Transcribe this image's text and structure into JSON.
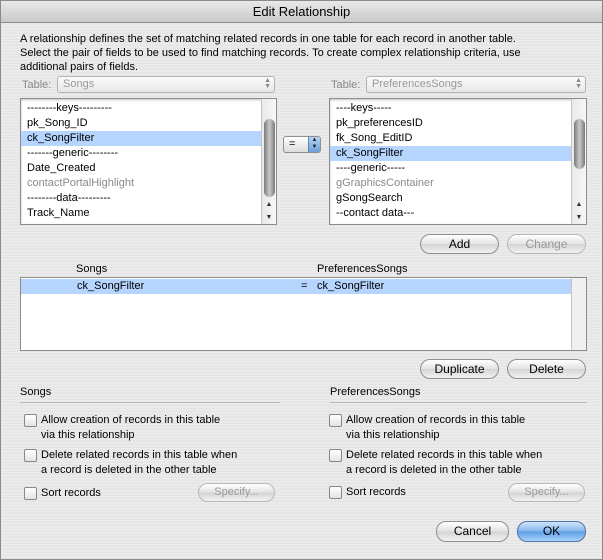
{
  "window": {
    "title": "Edit Relationship"
  },
  "description": [
    "A relationship defines the set of matching related records in one table for each record in another table.",
    "Select the pair of fields to be used to find matching records. To create complex relationship criteria, use",
    "additional pairs of fields."
  ],
  "left_table": {
    "label": "Table:",
    "selected": "Songs",
    "fields": [
      "--------keys---------",
      "pk_Song_ID",
      "ck_SongFilter",
      "-------generic--------",
      "Date_Created",
      "contactPortalHighlight",
      "--------data---------",
      "Track_Name"
    ],
    "selected_index": 2,
    "dim_indices": [
      5
    ]
  },
  "right_table": {
    "label": "Table:",
    "selected": "PreferencesSongs",
    "fields": [
      "----keys-----",
      "pk_preferencesID",
      "fk_Song_EditID",
      "ck_SongFilter",
      "----generic-----",
      "gGraphicsContainer",
      "gSongSearch",
      "--contact data---"
    ],
    "selected_index": 3,
    "dim_indices": [
      5
    ]
  },
  "operator": "=",
  "buttons": {
    "add": "Add",
    "change": "Change",
    "duplicate": "Duplicate",
    "delete": "Delete",
    "specify": "Specify...",
    "cancel": "Cancel",
    "ok": "OK"
  },
  "criteria": {
    "left_header": "Songs",
    "right_header": "PreferencesSongs",
    "rows": [
      {
        "left": "ck_SongFilter",
        "op": "=",
        "right": "ck_SongFilter"
      }
    ]
  },
  "options": {
    "left": {
      "title": "Songs",
      "allow_create": [
        "Allow creation of records in this table",
        "via this relationship"
      ],
      "delete_related": [
        "Delete related records in this table when",
        "a record is deleted in the other table"
      ],
      "sort": "Sort records"
    },
    "right": {
      "title": "PreferencesSongs",
      "allow_create": [
        "Allow creation of records in this table",
        "via this relationship"
      ],
      "delete_related": [
        "Delete related records in this table when",
        "a record is deleted in the other table"
      ],
      "sort": "Sort records"
    }
  },
  "colors": {
    "selection": "#b5d5ff",
    "default_button": "#5f9ee6"
  }
}
